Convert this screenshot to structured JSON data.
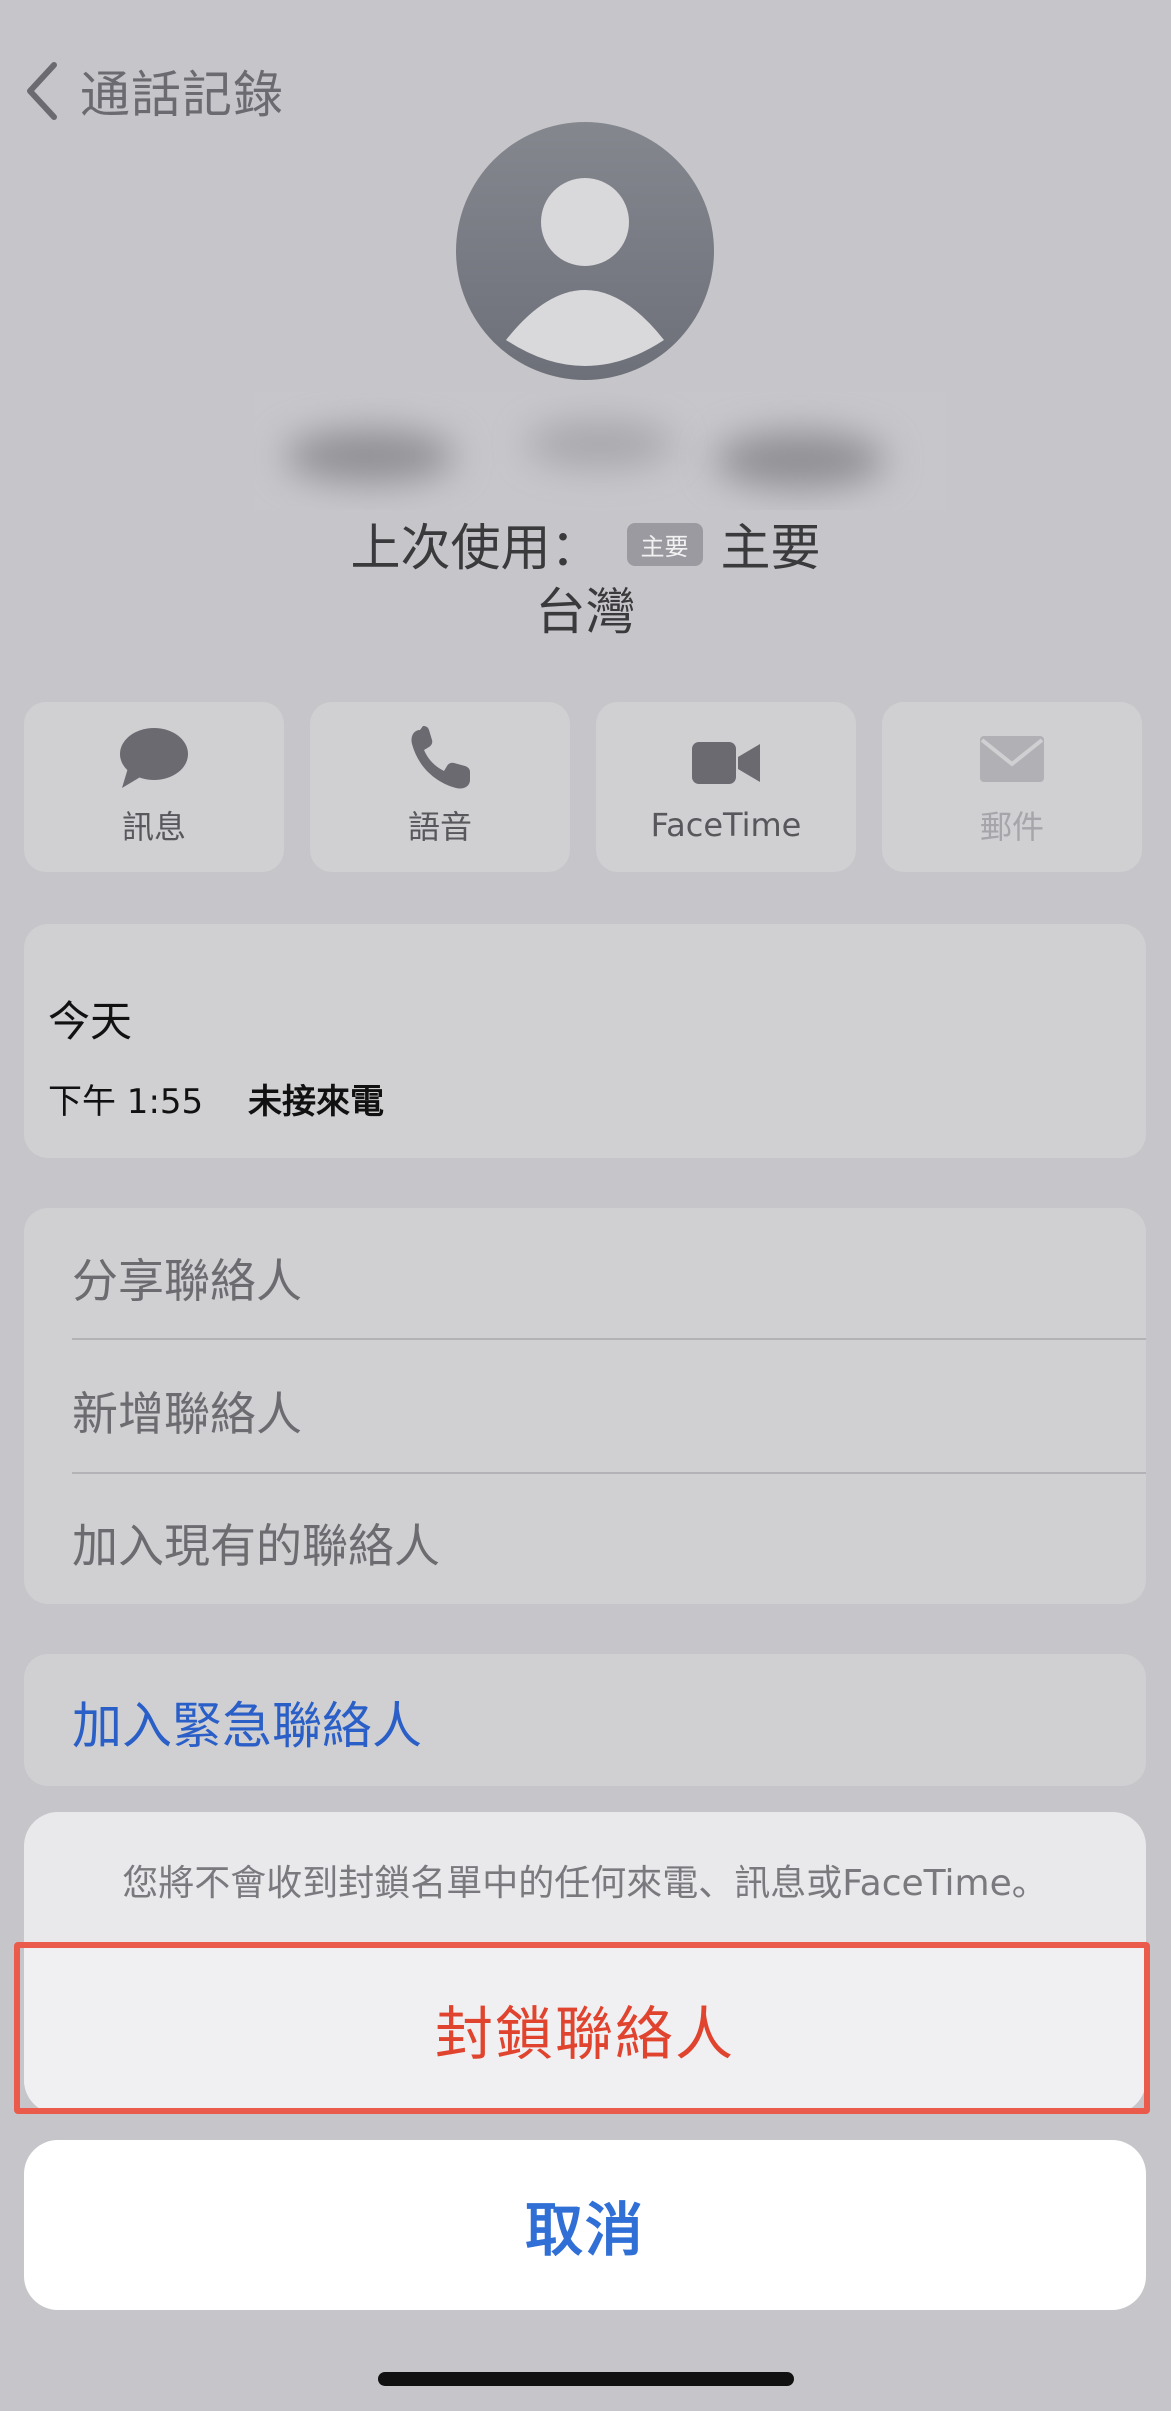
{
  "header": {
    "back_label": "通話記錄"
  },
  "contact": {
    "last_used_label": "上次使用：",
    "badge": "主要",
    "line_name": "主要",
    "region": "台灣"
  },
  "actions": [
    {
      "label": "訊息",
      "icon": "message-bubble-icon",
      "enabled": true
    },
    {
      "label": "語音",
      "icon": "phone-icon",
      "enabled": true
    },
    {
      "label": "FaceTime",
      "icon": "video-camera-icon",
      "enabled": true
    },
    {
      "label": "郵件",
      "icon": "envelope-icon",
      "enabled": false
    }
  ],
  "calls": {
    "day": "今天",
    "items": [
      {
        "time": "下午 1:55",
        "type": "未接來電"
      }
    ]
  },
  "menu": {
    "items": [
      "分享聯絡人",
      "新增聯絡人",
      "加入現有的聯絡人"
    ],
    "emergency": "加入緊急聯絡人"
  },
  "sheet": {
    "message": "您將不會收到封鎖名單中的任何來電、訊息或FaceTime。",
    "block_label": "封鎖聯絡人",
    "cancel_label": "取消"
  },
  "colors": {
    "destructive": "#e0432e",
    "link": "#2a5fc7",
    "highlight": "#ea5b4b"
  }
}
